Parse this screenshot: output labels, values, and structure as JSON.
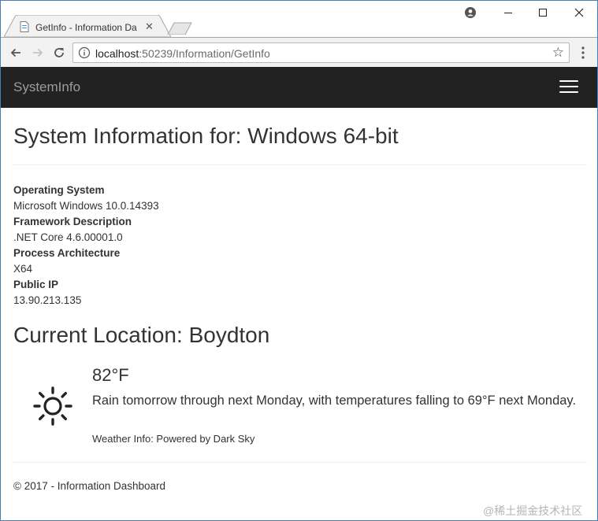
{
  "browser": {
    "tab_title": "GetInfo - Information Da",
    "url_host": "localhost",
    "url_rest": ":50239/Information/GetInfo"
  },
  "navbar": {
    "brand": "SystemInfo"
  },
  "main": {
    "title": "System Information for: Windows 64-bit",
    "info": [
      {
        "label": "Operating System",
        "value": "Microsoft Windows 10.0.14393"
      },
      {
        "label": "Framework Description",
        "value": ".NET Core 4.6.00001.0"
      },
      {
        "label": "Process Architecture",
        "value": "X64"
      },
      {
        "label": "Public IP",
        "value": "13.90.213.135"
      }
    ],
    "location_heading": "Current Location: Boydton",
    "weather": {
      "icon": "sun-icon",
      "temperature": "82°F",
      "summary": "Rain tomorrow through next Monday, with temperatures falling to 69°F next Monday.",
      "powered_by": "Weather Info: Powered by Dark Sky"
    }
  },
  "footer": {
    "text": "© 2017 - Information Dashboard"
  },
  "watermark": "@稀土掘金技术社区",
  "colors": {
    "navbar_bg": "#222222",
    "brand_text": "#9d9d9d",
    "window_border": "#4a7fb5"
  }
}
